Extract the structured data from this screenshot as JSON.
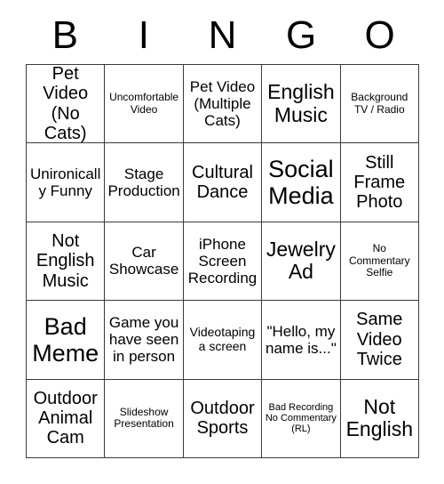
{
  "card": {
    "header_letters": [
      "B",
      "I",
      "N",
      "G",
      "O"
    ],
    "columns": 5,
    "rows": 5,
    "border_color": "#3a3a3a",
    "text_color": "#000000",
    "background_color": "#ffffff",
    "cells": [
      {
        "text": "Pet Video (No Cats)",
        "size": "lg"
      },
      {
        "text": "Uncomfortable Video",
        "size": "xs"
      },
      {
        "text": "Pet Video (Multiple Cats)",
        "size": "md"
      },
      {
        "text": "English Music",
        "size": "xl"
      },
      {
        "text": "Background TV / Radio",
        "size": "xs"
      },
      {
        "text": "Unironically Funny",
        "size": "md"
      },
      {
        "text": "Stage Production",
        "size": "md"
      },
      {
        "text": "Cultural Dance",
        "size": "lg"
      },
      {
        "text": "Social Media",
        "size": "xxl"
      },
      {
        "text": "Still Frame Photo",
        "size": "lg"
      },
      {
        "text": "Not English Music",
        "size": "lg"
      },
      {
        "text": "Car Showcase",
        "size": "md"
      },
      {
        "text": "iPhone Screen Recording",
        "size": "md"
      },
      {
        "text": "Jewelry Ad",
        "size": "xl"
      },
      {
        "text": "No Commentary Selfie",
        "size": "xs"
      },
      {
        "text": "Bad Meme",
        "size": "xxl"
      },
      {
        "text": "Game you have seen in person",
        "size": "md"
      },
      {
        "text": "Videotaping a screen",
        "size": "sm"
      },
      {
        "text": "\"Hello, my name is...\"",
        "size": "md"
      },
      {
        "text": "Same Video Twice",
        "size": "lg"
      },
      {
        "text": "Outdoor Animal Cam",
        "size": "lg"
      },
      {
        "text": "Slideshow Presentation",
        "size": "xs"
      },
      {
        "text": "Outdoor Sports",
        "size": "lg"
      },
      {
        "text": "Bad Recording No Commentary (RL)",
        "size": "xxs"
      },
      {
        "text": "Not English",
        "size": "xl"
      }
    ]
  }
}
